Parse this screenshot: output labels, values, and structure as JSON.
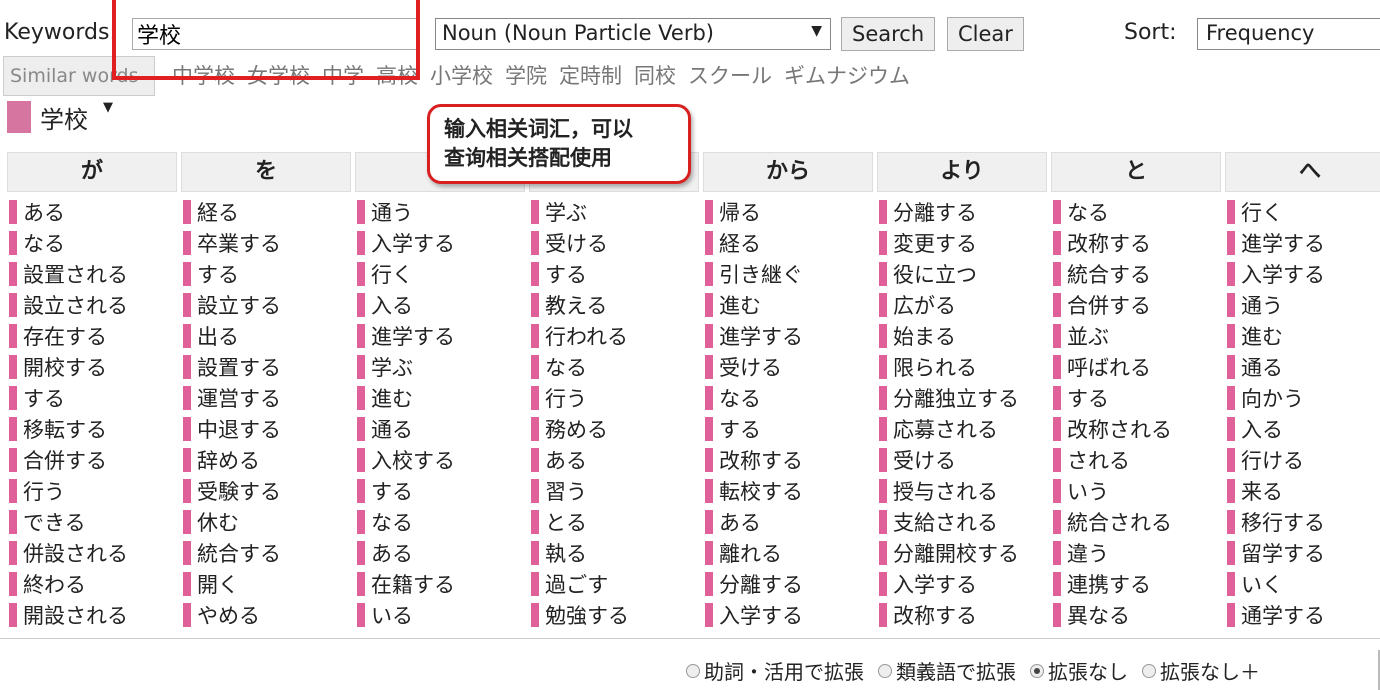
{
  "search": {
    "keywords_label": "Keywords:",
    "keyword_value": "学校",
    "pos_selected": "Noun (Noun Particle Verb)",
    "search_label": "Search",
    "clear_label": "Clear",
    "sort_label": "Sort:",
    "sort_selected": "Frequency"
  },
  "similar": {
    "button_label": "Similar words",
    "words": [
      "中学校",
      "女学校",
      "中学",
      "高校",
      "小学校",
      "学院",
      "定時制",
      "同校",
      "スクール",
      "ギムナジウム"
    ]
  },
  "keyword_header": {
    "title": "学校",
    "color": "#d6759f"
  },
  "callout": {
    "line1": "输入相关词汇，可以",
    "line2": "查询相关搭配使用"
  },
  "columns": [
    {
      "header": "が",
      "items": [
        "ある",
        "なる",
        "設置される",
        "設立される",
        "存在する",
        "開校する",
        "する",
        "移転する",
        "合併する",
        "行う",
        "できる",
        "併設される",
        "終わる",
        "開設される"
      ]
    },
    {
      "header": "を",
      "items": [
        "経る",
        "卒業する",
        "する",
        "設立する",
        "出る",
        "設置する",
        "運営する",
        "中退する",
        "辞める",
        "受験する",
        "休む",
        "統合する",
        "開く",
        "やめる"
      ]
    },
    {
      "header": "",
      "items": [
        "通う",
        "入学する",
        "行く",
        "入る",
        "進学する",
        "学ぶ",
        "進む",
        "通る",
        "入校する",
        "する",
        "なる",
        "ある",
        "在籍する",
        "いる"
      ]
    },
    {
      "header": "",
      "items": [
        "学ぶ",
        "受ける",
        "する",
        "教える",
        "行われる",
        "なる",
        "行う",
        "務める",
        "ある",
        "習う",
        "とる",
        "執る",
        "過ごす",
        "勉強する"
      ]
    },
    {
      "header": "から",
      "items": [
        "帰る",
        "経る",
        "引き継ぐ",
        "進む",
        "進学する",
        "受ける",
        "なる",
        "する",
        "改称する",
        "転校する",
        "ある",
        "離れる",
        "分離する",
        "入学する"
      ]
    },
    {
      "header": "より",
      "items": [
        "分離する",
        "変更する",
        "役に立つ",
        "広がる",
        "始まる",
        "限られる",
        "分離独立する",
        "応募される",
        "受ける",
        "授与される",
        "支給される",
        "分離開校する",
        "入学する",
        "改称する"
      ]
    },
    {
      "header": "と",
      "items": [
        "なる",
        "改称する",
        "統合する",
        "合併する",
        "並ぶ",
        "呼ばれる",
        "する",
        "改称される",
        "される",
        "いう",
        "統合される",
        "違う",
        "連携する",
        "異なる"
      ]
    },
    {
      "header": "へ",
      "items": [
        "行く",
        "進学する",
        "入学する",
        "通う",
        "進む",
        "通る",
        "向かう",
        "入る",
        "行ける",
        "来る",
        "移行する",
        "留学する",
        "いく",
        "通学する"
      ]
    }
  ],
  "expansion_options": [
    {
      "label": "助詞・活用で拡張",
      "selected": false
    },
    {
      "label": "類義語で拡張",
      "selected": false
    },
    {
      "label": "拡張なし",
      "selected": true
    },
    {
      "label": "拡張なし＋",
      "selected": false
    }
  ],
  "colors": {
    "bar": "#e0609a",
    "highlight": "#e02020"
  }
}
